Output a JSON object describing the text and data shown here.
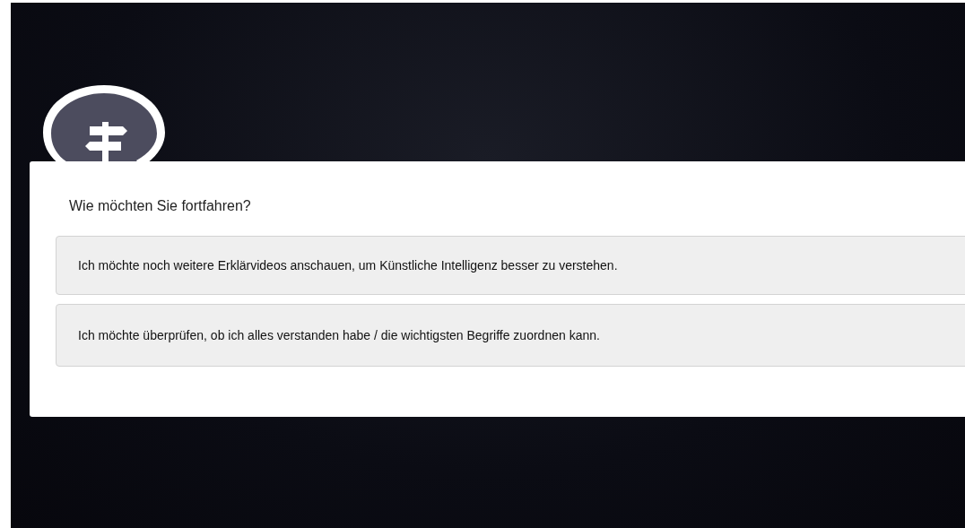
{
  "question": "Wie möchten Sie fortfahren?",
  "choices": [
    {
      "label": "Ich möchte noch weitere Erklärvideos anschauen, um Künstliche Intelligenz besser zu verstehen."
    },
    {
      "label": "Ich möchte überprüfen, ob ich alles verstanden habe / die wichtigsten Begriffe zuordnen kann."
    }
  ]
}
